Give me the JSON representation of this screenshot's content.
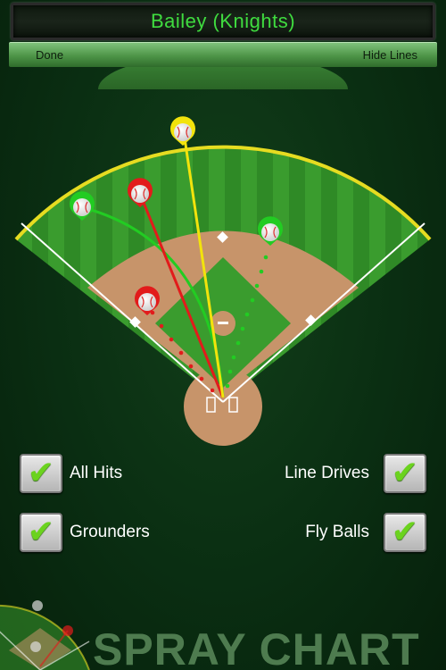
{
  "header": {
    "title": "Bailey (Knights)"
  },
  "nav": {
    "done_label": "Done",
    "hide_lines_label": "Hide Lines"
  },
  "filters": {
    "all_hits": {
      "label": "All Hits",
      "checked": true
    },
    "line_drives": {
      "label": "Line Drives",
      "checked": true
    },
    "grounders": {
      "label": "Grounders",
      "checked": true
    },
    "fly_balls": {
      "label": "Fly Balls",
      "checked": true
    }
  },
  "footer": {
    "text": "SPRAY CHART"
  },
  "colors": {
    "accent_green": "#3fdc3f",
    "hit_green": "#22cc22",
    "hit_red": "#e21b1b",
    "hit_yellow": "#f2e30c",
    "warning_track": "#e6dc21"
  },
  "hits": [
    {
      "id": "fly-left",
      "color": "green",
      "style": "curve"
    },
    {
      "id": "line-red-left",
      "color": "red",
      "style": "line"
    },
    {
      "id": "fly-yellow-center",
      "color": "yellow",
      "style": "line"
    },
    {
      "id": "ground-green-right",
      "color": "green",
      "style": "dotted"
    },
    {
      "id": "ground-red-left",
      "color": "red",
      "style": "dotted"
    }
  ]
}
